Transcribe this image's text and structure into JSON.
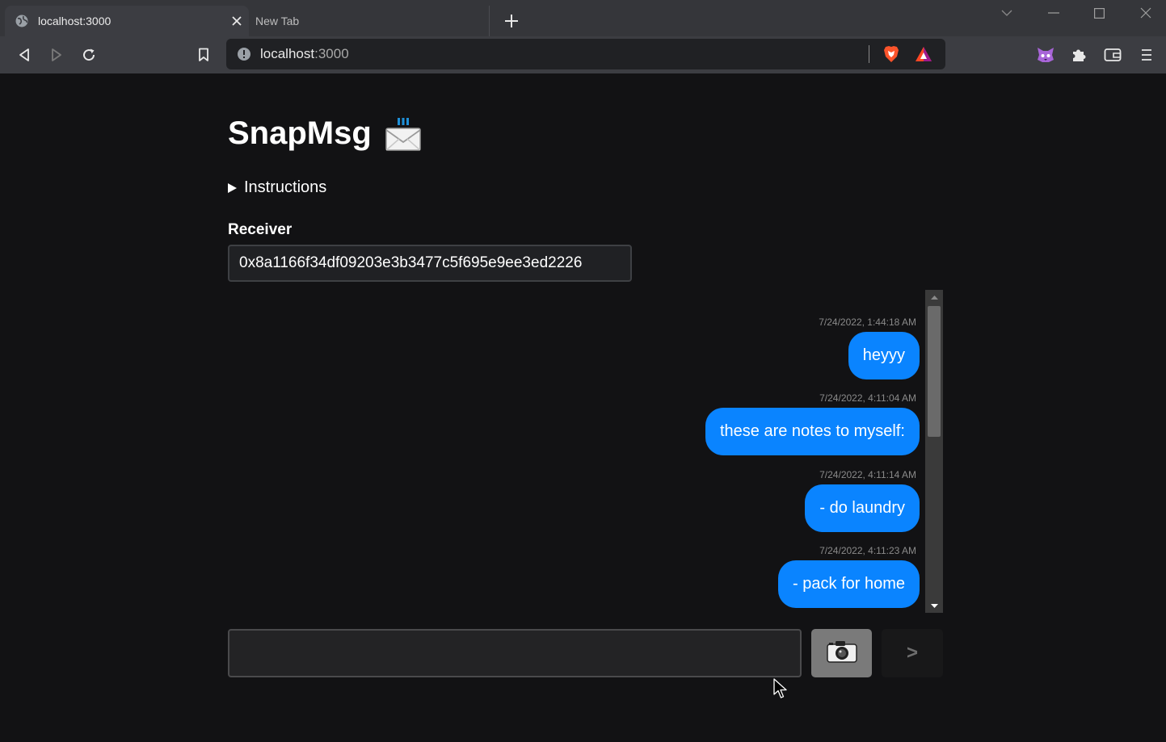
{
  "browser": {
    "tabs": [
      {
        "label": "localhost:3000",
        "active": true
      },
      {
        "label": "New Tab",
        "active": false
      }
    ],
    "url": {
      "host": "localhost",
      "port": ":3000"
    },
    "icons": {
      "back": "back-arrow-icon",
      "forward": "forward-arrow-icon",
      "reload": "reload-icon",
      "bookmark": "bookmark-icon",
      "site_info": "info-icon",
      "brave_shields": "brave-lion-icon",
      "brave_rewards": "rewards-triangle-icon",
      "extension_fox": "metamask-fox-icon",
      "extensions": "puzzle-icon",
      "wallet": "wallet-icon",
      "menu": "hamburger-menu-icon"
    }
  },
  "app": {
    "title": "SnapMsg",
    "instructions_label": "Instructions",
    "receiver_label": "Receiver",
    "receiver_value": "0x8a1166f34df09203e3b3477c5f695e9ee3ed2226",
    "compose_placeholder": "",
    "send_label": ">"
  },
  "messages": [
    {
      "time": "7/24/2022, 1:44:18 AM",
      "text": "heyyy"
    },
    {
      "time": "7/24/2022, 4:11:04 AM",
      "text": "these are notes to myself:"
    },
    {
      "time": "7/24/2022, 4:11:14 AM",
      "text": "- do laundry"
    },
    {
      "time": "7/24/2022, 4:11:23 AM",
      "text": "- pack for home"
    }
  ],
  "colors": {
    "bubble": "#0a84ff",
    "background": "#121214",
    "chrome": "#35363a"
  }
}
